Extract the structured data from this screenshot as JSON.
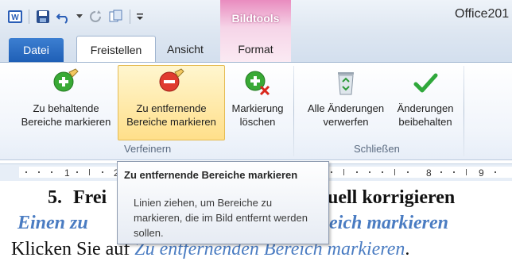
{
  "titlebar": {
    "app_title": "Office201",
    "context_group": "Bildtools"
  },
  "tabs": [
    {
      "label": "Datei"
    },
    {
      "label": "Freistellen"
    },
    {
      "label": "Ansicht"
    },
    {
      "label": "Format"
    }
  ],
  "ribbon": {
    "buttons": [
      {
        "line1": "Zu behaltende",
        "line2": "Bereiche markieren",
        "icon": "plus-pencil-icon"
      },
      {
        "line1": "Zu entfernende",
        "line2": "Bereiche markieren",
        "icon": "minus-pencil-icon"
      },
      {
        "line1": "Markierung",
        "line2": "löschen",
        "icon": "delete-mark-icon"
      },
      {
        "line1": "Alle Änderungen",
        "line2": "verwerfen",
        "icon": "recycle-bin-icon"
      },
      {
        "line1": "Änderungen",
        "line2": "beibehalten",
        "icon": "checkmark-icon"
      }
    ],
    "groups": {
      "verfeinern": "Verfeinern",
      "schliessen": "Schließen"
    }
  },
  "ruler": {
    "numbers": [
      "1",
      "2",
      "8",
      "9"
    ]
  },
  "tooltip": {
    "title": "Zu entfernende Bereiche markieren",
    "body": "Linien ziehen, um Bereiche zu markieren, die im Bild entfernt werden sollen."
  },
  "document": {
    "line1_num": "5.",
    "line1_left": "Frei",
    "line1_right": "uell korrigieren",
    "line2_left": "Einen zu",
    "line2_right": "eich markieren",
    "line3_left": "Klicken Sie auf ",
    "line3_link": "Zu entfernenden Bereich markieren",
    "line3_end": "."
  },
  "colors": {
    "accent": "#1f5fb6",
    "context_tab": "#e98cbf",
    "doc_link": "#4a7cc2",
    "active_button": "#ffdf8a"
  }
}
